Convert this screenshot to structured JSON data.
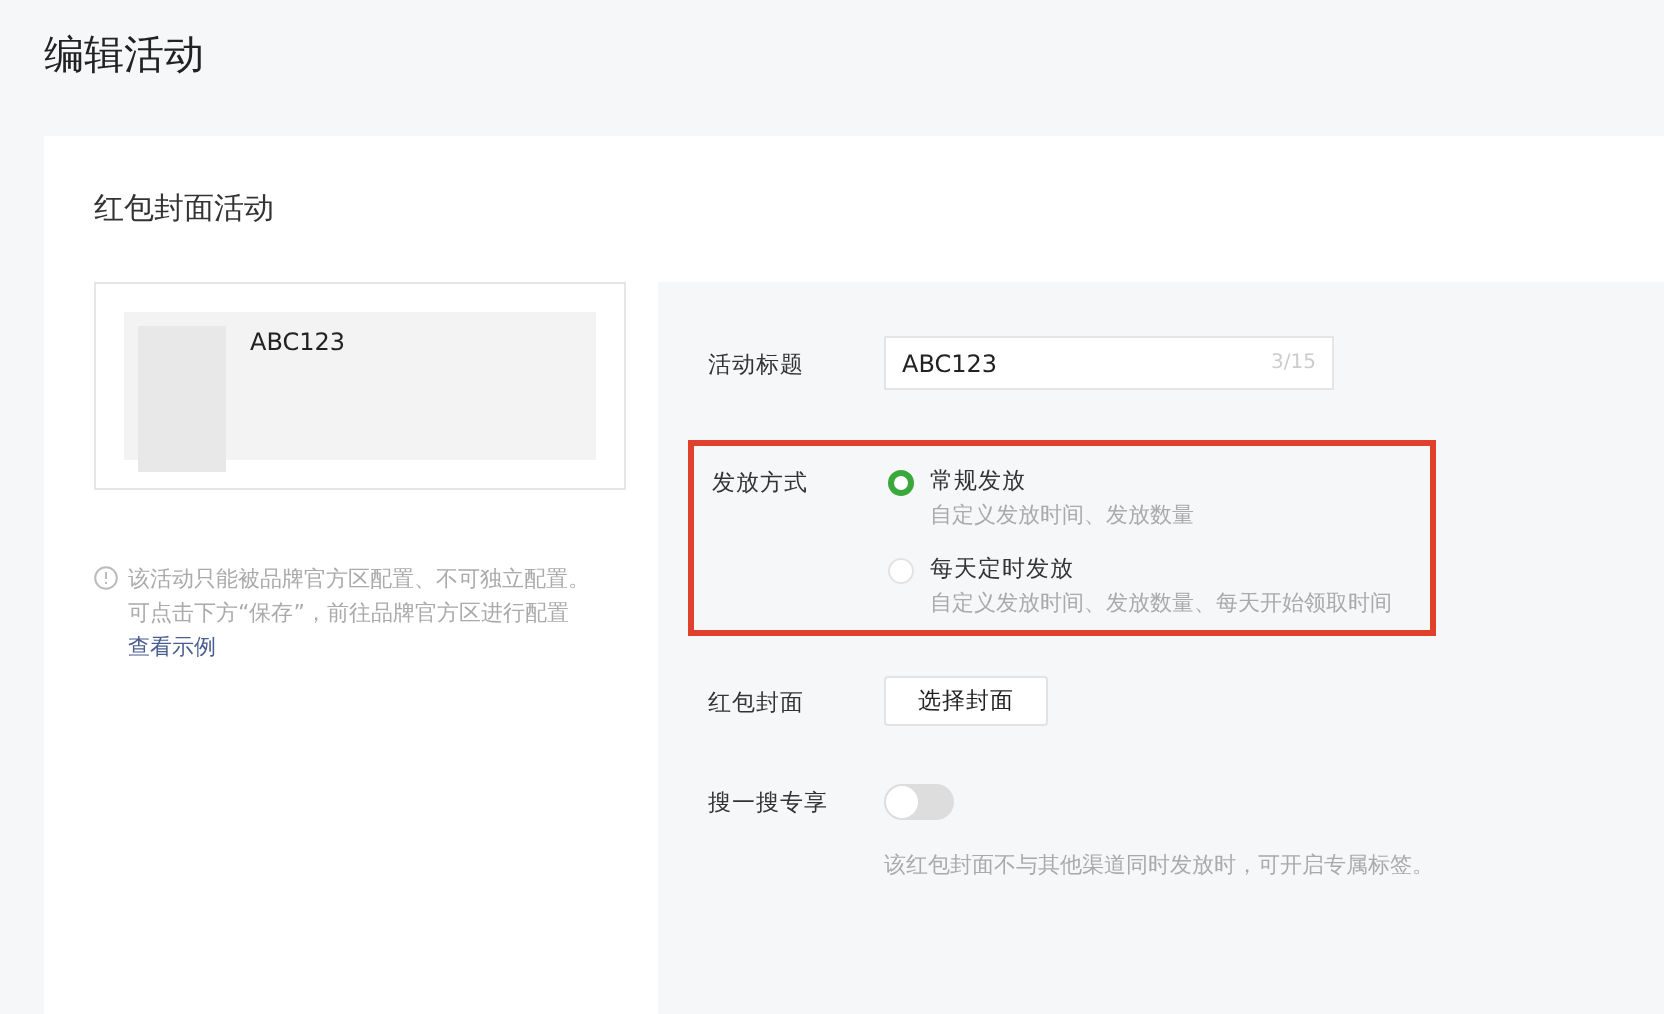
{
  "page_title": "编辑活动",
  "card": {
    "title": "红包封面活动",
    "preview": {
      "name": "ABC123"
    },
    "notice": {
      "lines": [
        "该活动只能被品牌官方区配置、不可独立配置。",
        "可点击下方“保存”，前往品牌官方区进行配置"
      ],
      "link": "查看示例"
    },
    "form": {
      "title_field": {
        "label": "活动标题",
        "value": "ABC123",
        "counter": "3/15"
      },
      "distribution": {
        "label": "发放方式",
        "highlighted": true,
        "options": [
          {
            "label": "常规发放",
            "description": "自定义发放时间、发放数量",
            "selected": true
          },
          {
            "label": "每天定时发放",
            "description": "自定义发放时间、发放数量、每天开始领取时间",
            "selected": false
          }
        ]
      },
      "cover": {
        "label": "红包封面",
        "button": "选择封面"
      },
      "search_exclusive": {
        "label": "搜一搜专享",
        "on": false,
        "hint": "该红包封面不与其他渠道同时发放时，可开启专属标签。"
      }
    }
  }
}
